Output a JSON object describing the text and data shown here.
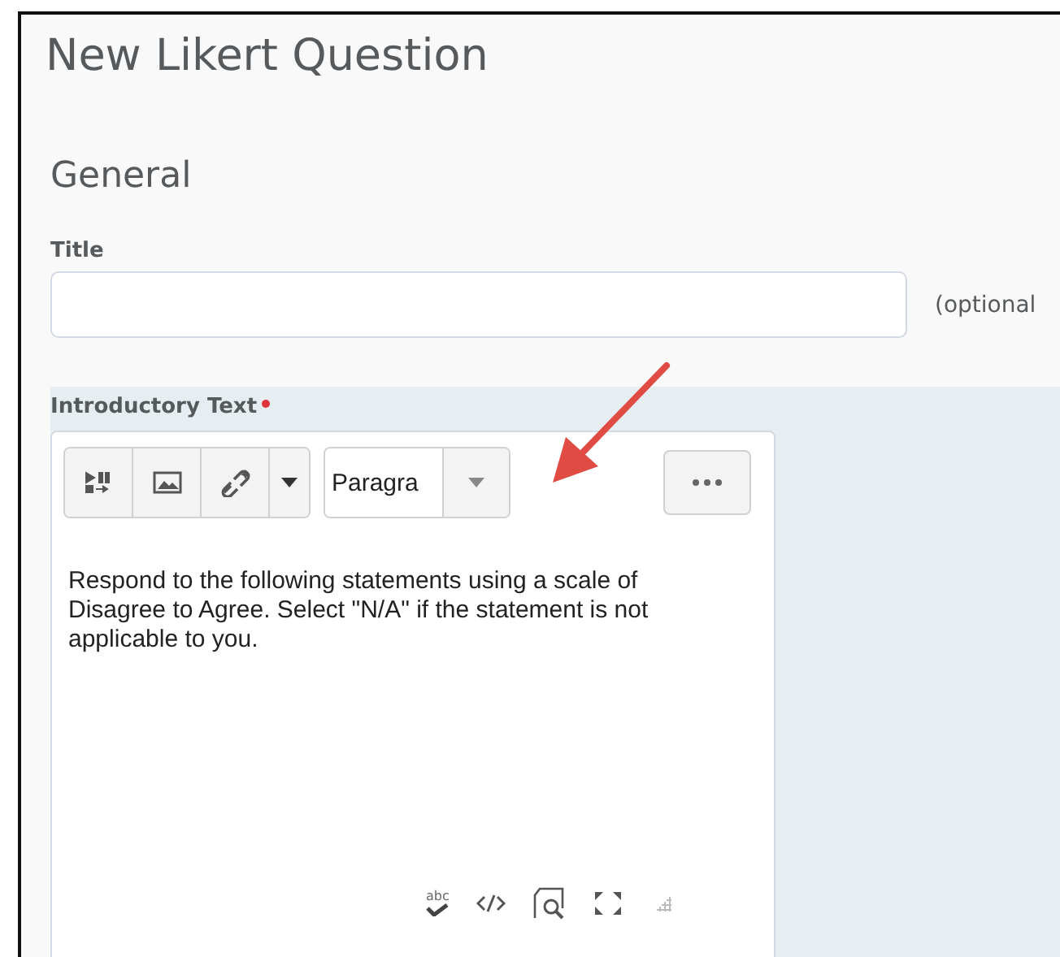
{
  "page": {
    "title": "New Likert Question"
  },
  "section": {
    "title": "General"
  },
  "title_field": {
    "label": "Title",
    "note": "(optional"
  },
  "intro": {
    "label": "Introductory Text",
    "required": true,
    "toolbar": {
      "format": "Paragra"
    },
    "body": "Respond to the following statements using a scale of Disagree to Agree. Select \"N/A\" if the statement is not applicable to you.",
    "spellcheck_label": "abc"
  }
}
